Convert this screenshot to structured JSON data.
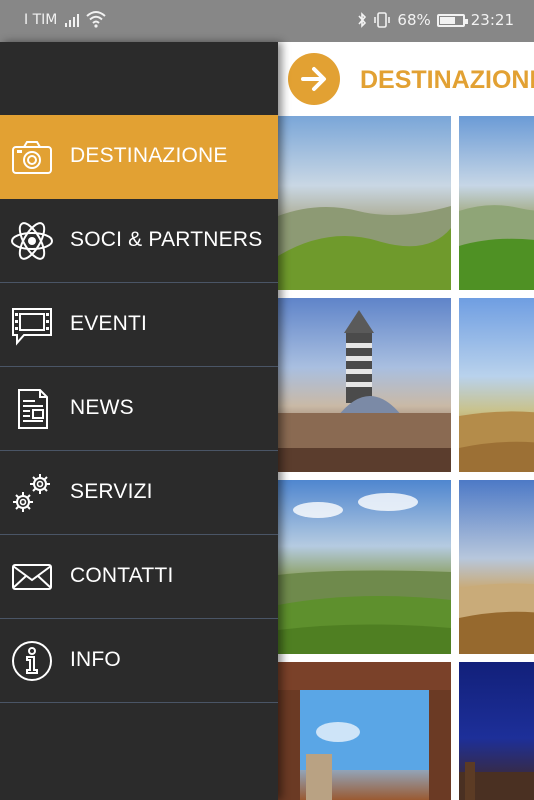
{
  "status_bar": {
    "carrier": "I TIM",
    "battery_text": "68%",
    "battery_level": 0.68,
    "time": "23:21",
    "icons": [
      "signal-icon",
      "wifi-icon",
      "bluetooth-icon",
      "vibrate-icon",
      "battery-icon"
    ]
  },
  "header": {
    "title": "DESTINAZIONE",
    "back_icon": "arrow-right-icon"
  },
  "drawer": {
    "items": [
      {
        "label": "DESTINAZIONE",
        "icon": "camera-icon",
        "active": true
      },
      {
        "label": "SOCI & PARTNERS",
        "icon": "atom-icon",
        "active": false
      },
      {
        "label": "EVENTI",
        "icon": "film-chat-icon",
        "active": false
      },
      {
        "label": "NEWS",
        "icon": "newspaper-icon",
        "active": false
      },
      {
        "label": "SERVIZI",
        "icon": "gears-icon",
        "active": false
      },
      {
        "label": "CONTATTI",
        "icon": "envelope-icon",
        "active": false
      },
      {
        "label": "INFO",
        "icon": "info-icon",
        "active": false
      }
    ]
  },
  "gallery": {
    "tiles": [
      "landscape-hills",
      "landscape-hills",
      "siena-cathedral",
      "landscape-fields",
      "landscape-green-hills",
      "landscape-sunset-fields",
      "courtyard-tower",
      "night-sky"
    ]
  },
  "colors": {
    "accent": "#e2a133",
    "drawer_bg": "#2b2b2b",
    "status_bar_bg": "#878787",
    "divider": "#4a5566"
  }
}
